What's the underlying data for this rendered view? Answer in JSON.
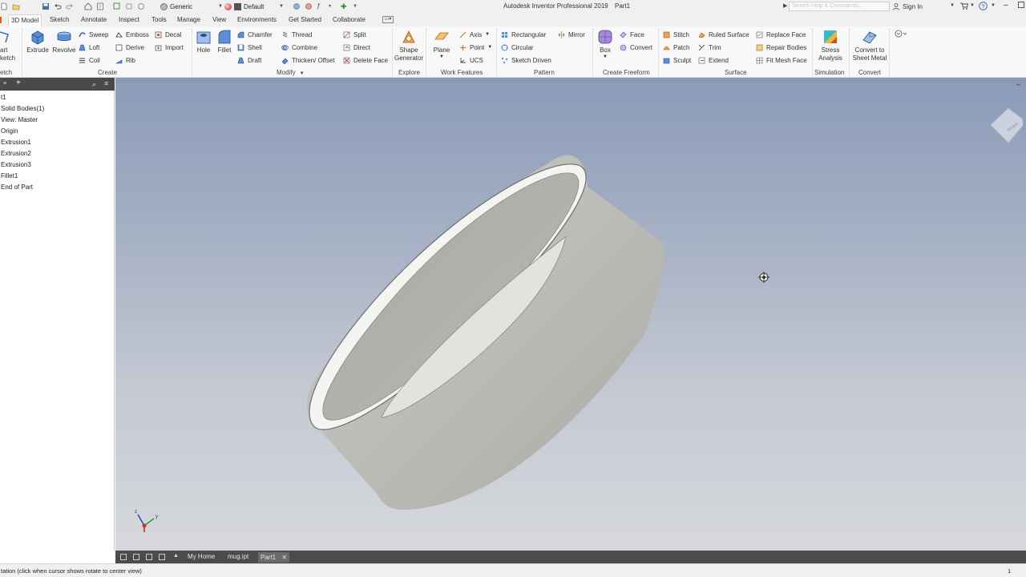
{
  "titlebar": {
    "material_combo": "Generic",
    "appearance_combo": "Default",
    "app_title": "Autodesk Inventor Professional 2019",
    "doc_title": "Part1",
    "search_placeholder": "Search Help & Commands...",
    "signin": "Sign In"
  },
  "tabs": [
    {
      "label": "3D Model",
      "active": true
    },
    {
      "label": "Sketch"
    },
    {
      "label": "Annotate"
    },
    {
      "label": "Inspect"
    },
    {
      "label": "Tools"
    },
    {
      "label": "Manage"
    },
    {
      "label": "View"
    },
    {
      "label": "Environments"
    },
    {
      "label": "Get Started"
    },
    {
      "label": "Collaborate"
    }
  ],
  "ribbon": {
    "start_sketch": {
      "line1": "art",
      "line2": "ketch"
    },
    "sketch_panel_label": "etch",
    "create": {
      "extrude": "Extrude",
      "revolve": "Revolve",
      "sweep": "Sweep",
      "loft": "Loft",
      "coil": "Coil",
      "emboss": "Emboss",
      "derive": "Derive",
      "rib": "Rib",
      "decal": "Decal",
      "import": "Import",
      "label": "Create"
    },
    "modify": {
      "hole": "Hole",
      "fillet": "Fillet",
      "chamfer": "Chamfer",
      "shell": "Shell",
      "draft": "Draft",
      "thread": "Thread",
      "combine": "Combine",
      "thicken": "Thicken/ Offset",
      "split": "Split",
      "direct": "Direct",
      "delete_face": "Delete Face",
      "label": "Modify"
    },
    "explore": {
      "shape_line1": "Shape",
      "shape_line2": "Generator",
      "label": "Explore"
    },
    "work_features": {
      "plane": "Plane",
      "axis": "Axis",
      "point": "Point",
      "ucs": "UCS",
      "label": "Work Features"
    },
    "pattern": {
      "rectangular": "Rectangular",
      "circular": "Circular",
      "sketch_driven": "Sketch Driven",
      "mirror": "Mirror",
      "label": "Pattern"
    },
    "freeform": {
      "box": "Box",
      "face": "Face",
      "convert": "Convert",
      "label": "Create Freeform"
    },
    "surface": {
      "stitch": "Stitch",
      "patch": "Patch",
      "sculpt": "Sculpt",
      "ruled_surface": "Ruled Surface",
      "trim": "Trim",
      "extend": "Extend",
      "replace_face": "Replace Face",
      "repair_bodies": "Repair Bodies",
      "fit_mesh_face": "Fit Mesh Face",
      "label": "Surface"
    },
    "simulation": {
      "line1": "Stress",
      "line2": "Analysis",
      "label": "Simulation"
    },
    "convert": {
      "line1": "Convert to",
      "line2": "Sheet Metal",
      "label": "Convert"
    }
  },
  "browser": {
    "items": [
      "t1",
      "Solid Bodies(1)",
      "View: Master",
      "Origin",
      "Extrusion1",
      "Extrusion2",
      "Extrusion3",
      "Fillet1",
      "End of Part"
    ]
  },
  "viewcube": {
    "face_label": "RIGHT"
  },
  "doctabs": {
    "items": [
      "My Home",
      "mug.ipt",
      "Part1"
    ],
    "active": "Part1"
  },
  "status": {
    "text": "tation (click when cursor shows rotate to center view)",
    "page_number": "1"
  },
  "colors": {
    "viewport_top": "#8a9ab8",
    "viewport_bottom": "#d6d8dc",
    "ribbon_bg": "#f8f8f8",
    "doc_tab_bar": "#4b4b4b"
  }
}
